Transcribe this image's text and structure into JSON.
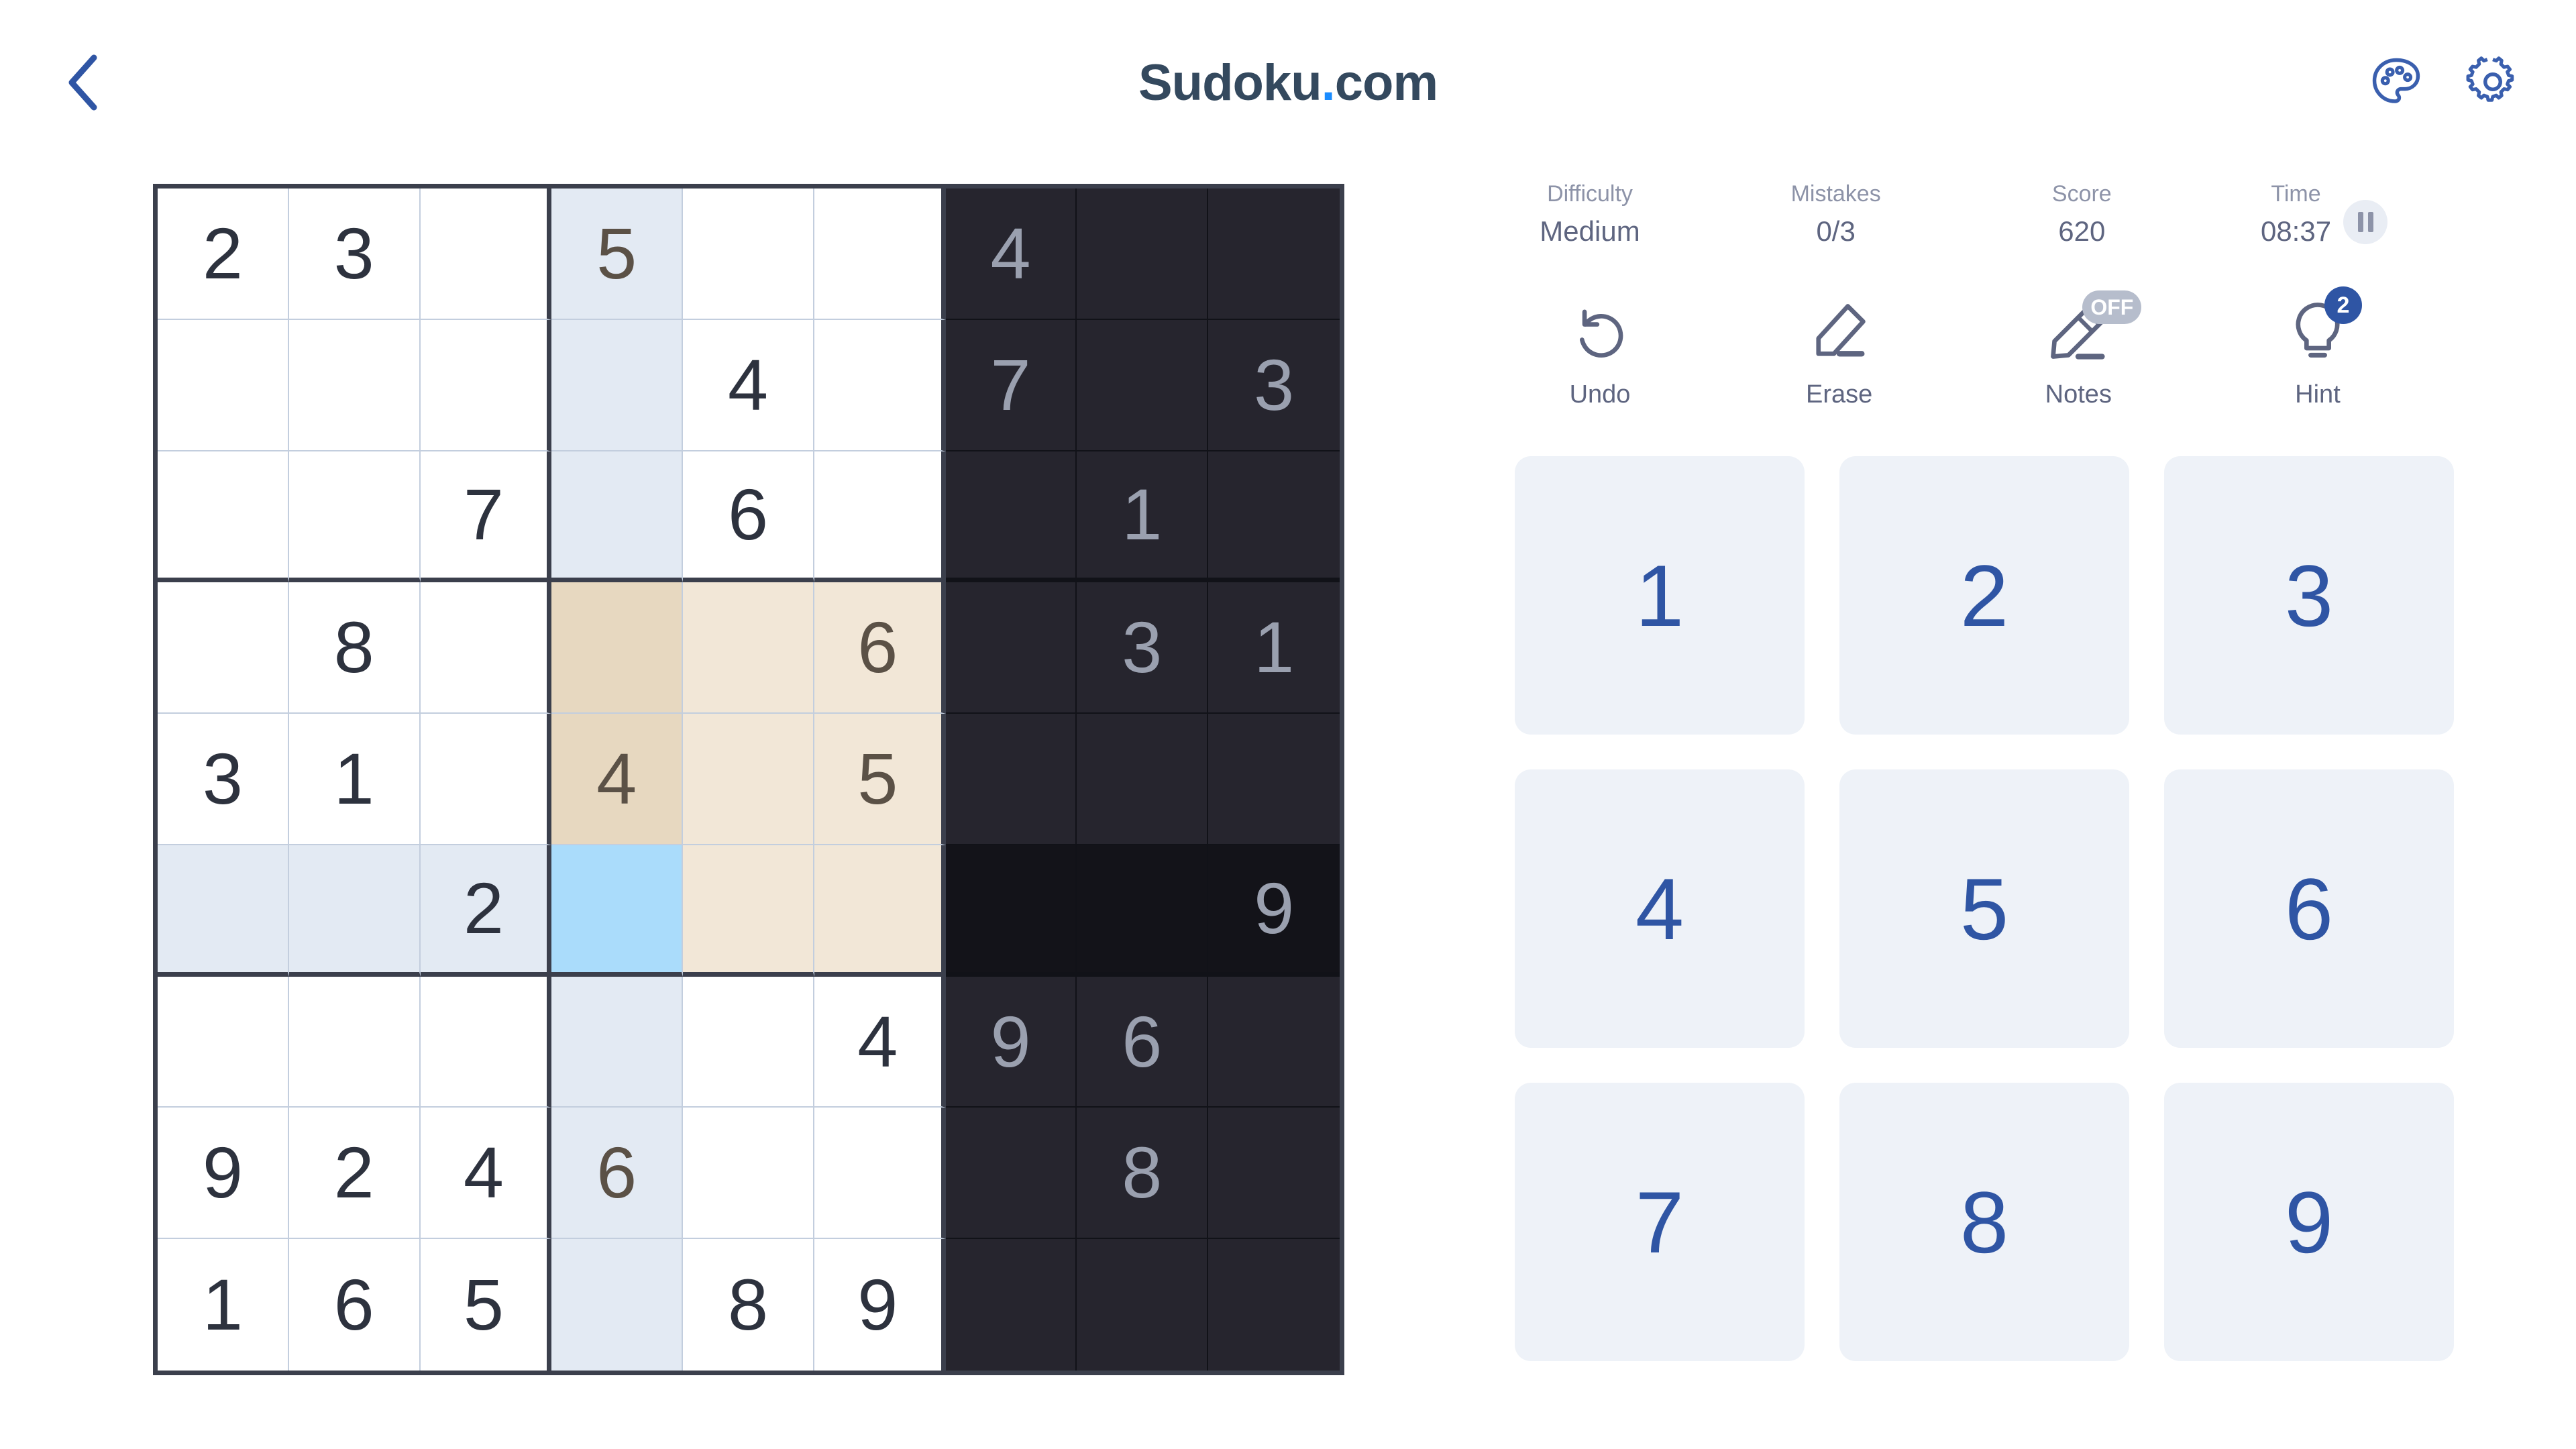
{
  "header": {
    "title_main": "Sudoku",
    "title_dot": ".",
    "title_tld": "com",
    "back_icon": "chevron-left-icon",
    "theme_icon": "palette-icon",
    "settings_icon": "gear-icon"
  },
  "stats": {
    "difficulty_label": "Difficulty",
    "difficulty_value": "Medium",
    "mistakes_label": "Mistakes",
    "mistakes_value": "0/3",
    "score_label": "Score",
    "score_value": "620",
    "time_label": "Time",
    "time_value": "08:37",
    "pause_icon": "pause-icon"
  },
  "actions": [
    {
      "label": "Undo",
      "icon": "undo-arrow-icon",
      "badge": null,
      "badge_type": null
    },
    {
      "label": "Erase",
      "icon": "eraser-icon",
      "badge": null,
      "badge_type": null
    },
    {
      "label": "Notes",
      "icon": "pencil-icon",
      "badge": "OFF",
      "badge_type": "off"
    },
    {
      "label": "Hint",
      "icon": "lightbulb-icon",
      "badge": "2",
      "badge_type": "count"
    }
  ],
  "numpad": {
    "keys": [
      "1",
      "2",
      "3",
      "4",
      "5",
      "6",
      "7",
      "8",
      "9"
    ]
  },
  "colors": {
    "accent_blue": "#2f55a4",
    "title_navy": "#34495e",
    "dot_blue": "#1a8cff",
    "selected_cell": "#aadcfb",
    "col_highlight_beige": "#e7d8c0",
    "box_highlight_beige": "#f2e7d7",
    "row_highlight_blue": "#e3eaf3",
    "dark_region": "#26252e",
    "dark_region_row": "#131319",
    "grid_line": "#c3cede",
    "grid_border": "#3b3f4c",
    "given_text": "#2d323e",
    "dark_text": "#9aa0af",
    "beige_text": "#5b5146"
  },
  "board": {
    "selected": {
      "row": 6,
      "col": 4
    },
    "dark_columns": [
      7,
      8,
      9
    ],
    "highlight_row": 6,
    "highlight_col": 4,
    "highlight_box": {
      "row_start": 4,
      "col_start": 4
    },
    "grid": [
      [
        "2",
        "3",
        "",
        "5",
        "",
        "",
        "4",
        "",
        ""
      ],
      [
        "",
        "",
        "",
        "",
        "4",
        "",
        "7",
        "",
        "3"
      ],
      [
        "",
        "",
        "7",
        "",
        "6",
        "",
        "",
        "1",
        ""
      ],
      [
        "",
        "8",
        "",
        "",
        "",
        "6",
        "",
        "3",
        "1"
      ],
      [
        "3",
        "1",
        "",
        "4",
        "",
        "5",
        "",
        "",
        ""
      ],
      [
        "",
        "",
        "2",
        "",
        "",
        "",
        "",
        "",
        "9"
      ],
      [
        "",
        "",
        "",
        "",
        "",
        "4",
        "9",
        "6",
        ""
      ],
      [
        "9",
        "2",
        "4",
        "6",
        "",
        "",
        "",
        "8",
        ""
      ],
      [
        "1",
        "6",
        "5",
        "",
        "8",
        "9",
        "",
        "",
        ""
      ]
    ]
  }
}
